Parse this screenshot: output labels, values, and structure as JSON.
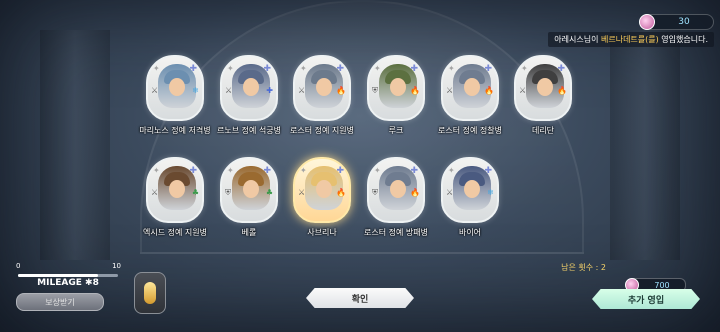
{
  "notice": {
    "coins": "30",
    "coin_icon": "coin-icon",
    "message_prefix": "아레시스님이 ",
    "message_highlight": "베르나데트를(를)",
    "message_suffix": " 영입했습니다."
  },
  "cards": [
    {
      "name": "마리노스 정예 저격병",
      "frame": "silver",
      "icon_left": "crossed-swords-icon",
      "icon_right": "snowflake-icon",
      "color": "#6c8fb0"
    },
    {
      "name": "르노브 정예 석궁병",
      "frame": "silver",
      "icon_left": "crossed-swords-icon",
      "icon_right": "cross-icon",
      "color": "#5a6a8a"
    },
    {
      "name": "로스터 정예 지원병",
      "frame": "silver",
      "icon_left": "crossed-swords-icon",
      "icon_right": "fire-icon",
      "color": "#6c7a8c"
    },
    {
      "name": "루크",
      "frame": "silver",
      "icon_left": "shield-icon",
      "icon_right": "fire-icon",
      "color": "#5c7040"
    },
    {
      "name": "로스터 정예 정찰병",
      "frame": "silver",
      "icon_left": "crossed-swords-icon",
      "icon_right": "fire-icon",
      "color": "#6f7c90"
    },
    {
      "name": "데리단",
      "frame": "silver",
      "icon_left": "crossed-swords-icon",
      "icon_right": "fire-icon",
      "color": "#3f3f3f"
    },
    {
      "name": "엑시드 정예 지원병",
      "frame": "silver",
      "icon_left": "crossed-swords-icon",
      "icon_right": "clover-icon",
      "color": "#6a4a30"
    },
    {
      "name": "베롤",
      "frame": "silver",
      "icon_left": "shield-icon",
      "icon_right": "clover-icon",
      "color": "#9a6a30"
    },
    {
      "name": "사브리나",
      "frame": "gold",
      "icon_left": "crossed-swords-icon",
      "icon_right": "fire-icon",
      "color": "#e6c070"
    },
    {
      "name": "로스터 정예 방패병",
      "frame": "silver",
      "icon_left": "shield-icon",
      "icon_right": "fire-icon",
      "color": "#6f7c90"
    },
    {
      "name": "바이어",
      "frame": "silver",
      "icon_left": "crossed-swords-icon",
      "icon_right": "snowflake-icon",
      "color": "#4a5a80"
    }
  ],
  "mileage": {
    "min": "0",
    "max": "10",
    "value": 8,
    "label": "MILEAGE",
    "star": "✱",
    "value_text": "8",
    "reward_button": "보상받기"
  },
  "confirm_button": "확인",
  "remaining": "남은 횟수 : 2",
  "extra": {
    "cost": "700",
    "button": "추가 영입"
  }
}
